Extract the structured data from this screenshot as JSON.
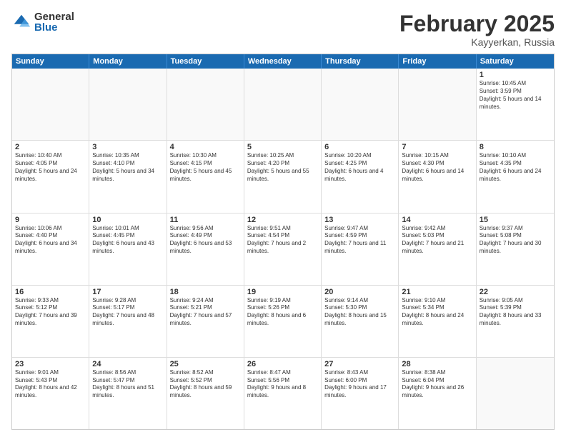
{
  "logo": {
    "general": "General",
    "blue": "Blue"
  },
  "title": {
    "month": "February 2025",
    "location": "Kayyerkan, Russia"
  },
  "header": {
    "days": [
      "Sunday",
      "Monday",
      "Tuesday",
      "Wednesday",
      "Thursday",
      "Friday",
      "Saturday"
    ]
  },
  "weeks": [
    [
      {
        "day": "",
        "text": ""
      },
      {
        "day": "",
        "text": ""
      },
      {
        "day": "",
        "text": ""
      },
      {
        "day": "",
        "text": ""
      },
      {
        "day": "",
        "text": ""
      },
      {
        "day": "",
        "text": ""
      },
      {
        "day": "1",
        "text": "Sunrise: 10:45 AM\nSunset: 3:59 PM\nDaylight: 5 hours and 14 minutes."
      }
    ],
    [
      {
        "day": "2",
        "text": "Sunrise: 10:40 AM\nSunset: 4:05 PM\nDaylight: 5 hours and 24 minutes."
      },
      {
        "day": "3",
        "text": "Sunrise: 10:35 AM\nSunset: 4:10 PM\nDaylight: 5 hours and 34 minutes."
      },
      {
        "day": "4",
        "text": "Sunrise: 10:30 AM\nSunset: 4:15 PM\nDaylight: 5 hours and 45 minutes."
      },
      {
        "day": "5",
        "text": "Sunrise: 10:25 AM\nSunset: 4:20 PM\nDaylight: 5 hours and 55 minutes."
      },
      {
        "day": "6",
        "text": "Sunrise: 10:20 AM\nSunset: 4:25 PM\nDaylight: 6 hours and 4 minutes."
      },
      {
        "day": "7",
        "text": "Sunrise: 10:15 AM\nSunset: 4:30 PM\nDaylight: 6 hours and 14 minutes."
      },
      {
        "day": "8",
        "text": "Sunrise: 10:10 AM\nSunset: 4:35 PM\nDaylight: 6 hours and 24 minutes."
      }
    ],
    [
      {
        "day": "9",
        "text": "Sunrise: 10:06 AM\nSunset: 4:40 PM\nDaylight: 6 hours and 34 minutes."
      },
      {
        "day": "10",
        "text": "Sunrise: 10:01 AM\nSunset: 4:45 PM\nDaylight: 6 hours and 43 minutes."
      },
      {
        "day": "11",
        "text": "Sunrise: 9:56 AM\nSunset: 4:49 PM\nDaylight: 6 hours and 53 minutes."
      },
      {
        "day": "12",
        "text": "Sunrise: 9:51 AM\nSunset: 4:54 PM\nDaylight: 7 hours and 2 minutes."
      },
      {
        "day": "13",
        "text": "Sunrise: 9:47 AM\nSunset: 4:59 PM\nDaylight: 7 hours and 11 minutes."
      },
      {
        "day": "14",
        "text": "Sunrise: 9:42 AM\nSunset: 5:03 PM\nDaylight: 7 hours and 21 minutes."
      },
      {
        "day": "15",
        "text": "Sunrise: 9:37 AM\nSunset: 5:08 PM\nDaylight: 7 hours and 30 minutes."
      }
    ],
    [
      {
        "day": "16",
        "text": "Sunrise: 9:33 AM\nSunset: 5:12 PM\nDaylight: 7 hours and 39 minutes."
      },
      {
        "day": "17",
        "text": "Sunrise: 9:28 AM\nSunset: 5:17 PM\nDaylight: 7 hours and 48 minutes."
      },
      {
        "day": "18",
        "text": "Sunrise: 9:24 AM\nSunset: 5:21 PM\nDaylight: 7 hours and 57 minutes."
      },
      {
        "day": "19",
        "text": "Sunrise: 9:19 AM\nSunset: 5:26 PM\nDaylight: 8 hours and 6 minutes."
      },
      {
        "day": "20",
        "text": "Sunrise: 9:14 AM\nSunset: 5:30 PM\nDaylight: 8 hours and 15 minutes."
      },
      {
        "day": "21",
        "text": "Sunrise: 9:10 AM\nSunset: 5:34 PM\nDaylight: 8 hours and 24 minutes."
      },
      {
        "day": "22",
        "text": "Sunrise: 9:05 AM\nSunset: 5:39 PM\nDaylight: 8 hours and 33 minutes."
      }
    ],
    [
      {
        "day": "23",
        "text": "Sunrise: 9:01 AM\nSunset: 5:43 PM\nDaylight: 8 hours and 42 minutes."
      },
      {
        "day": "24",
        "text": "Sunrise: 8:56 AM\nSunset: 5:47 PM\nDaylight: 8 hours and 51 minutes."
      },
      {
        "day": "25",
        "text": "Sunrise: 8:52 AM\nSunset: 5:52 PM\nDaylight: 8 hours and 59 minutes."
      },
      {
        "day": "26",
        "text": "Sunrise: 8:47 AM\nSunset: 5:56 PM\nDaylight: 9 hours and 8 minutes."
      },
      {
        "day": "27",
        "text": "Sunrise: 8:43 AM\nSunset: 6:00 PM\nDaylight: 9 hours and 17 minutes."
      },
      {
        "day": "28",
        "text": "Sunrise: 8:38 AM\nSunset: 6:04 PM\nDaylight: 9 hours and 26 minutes."
      },
      {
        "day": "",
        "text": ""
      }
    ]
  ]
}
